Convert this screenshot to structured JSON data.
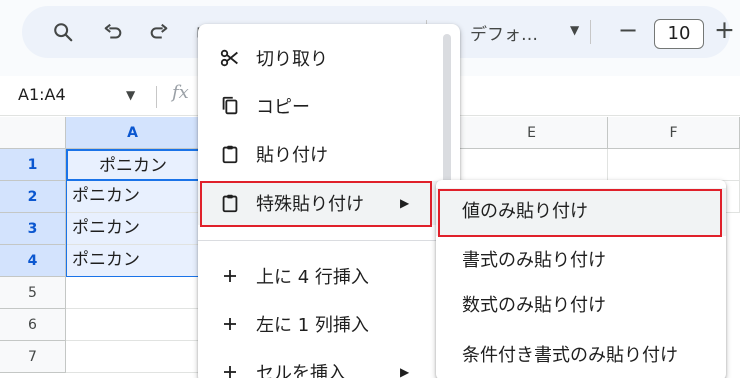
{
  "toolbar": {
    "icons": [
      "search-icon",
      "undo-icon",
      "redo-icon",
      "print-icon",
      "paint-format-icon"
    ],
    "font_name": "デフォ…",
    "font_size": "10",
    "minus_label": "−",
    "plus_label": "+"
  },
  "formula_bar": {
    "name_box": "A1:A4",
    "fx_label": "fx"
  },
  "grid": {
    "columns": [
      "A",
      "E",
      "F"
    ],
    "rows": [
      "1",
      "2",
      "3",
      "4",
      "5",
      "6",
      "7"
    ],
    "cells": [
      "ポニカン",
      "ポニカン",
      "ポニカン",
      "ポニカン"
    ]
  },
  "context_menu": {
    "items": [
      {
        "label": "切り取り",
        "icon": "scissors-icon"
      },
      {
        "label": "コピー",
        "icon": "copy-icon"
      },
      {
        "label": "貼り付け",
        "icon": "clipboard-icon"
      },
      {
        "label": "特殊貼り付け",
        "icon": "clipboard-icon",
        "arrow": "▶"
      },
      {
        "label": "上に 4 行挿入",
        "icon": "plus-icon"
      },
      {
        "label": "左に 1 列挿入",
        "icon": "plus-icon"
      },
      {
        "label": "セルを挿入",
        "icon": "plus-icon",
        "arrow": "▶"
      }
    ]
  },
  "submenu": {
    "items": [
      "値のみ貼り付け",
      "書式のみ貼り付け",
      "数式のみ貼り付け",
      "条件付き書式のみ貼り付け"
    ]
  },
  "colors": {
    "selection": "#d3e3fd",
    "accent": "#1a73e8",
    "highlight_box": "#e0202a"
  }
}
